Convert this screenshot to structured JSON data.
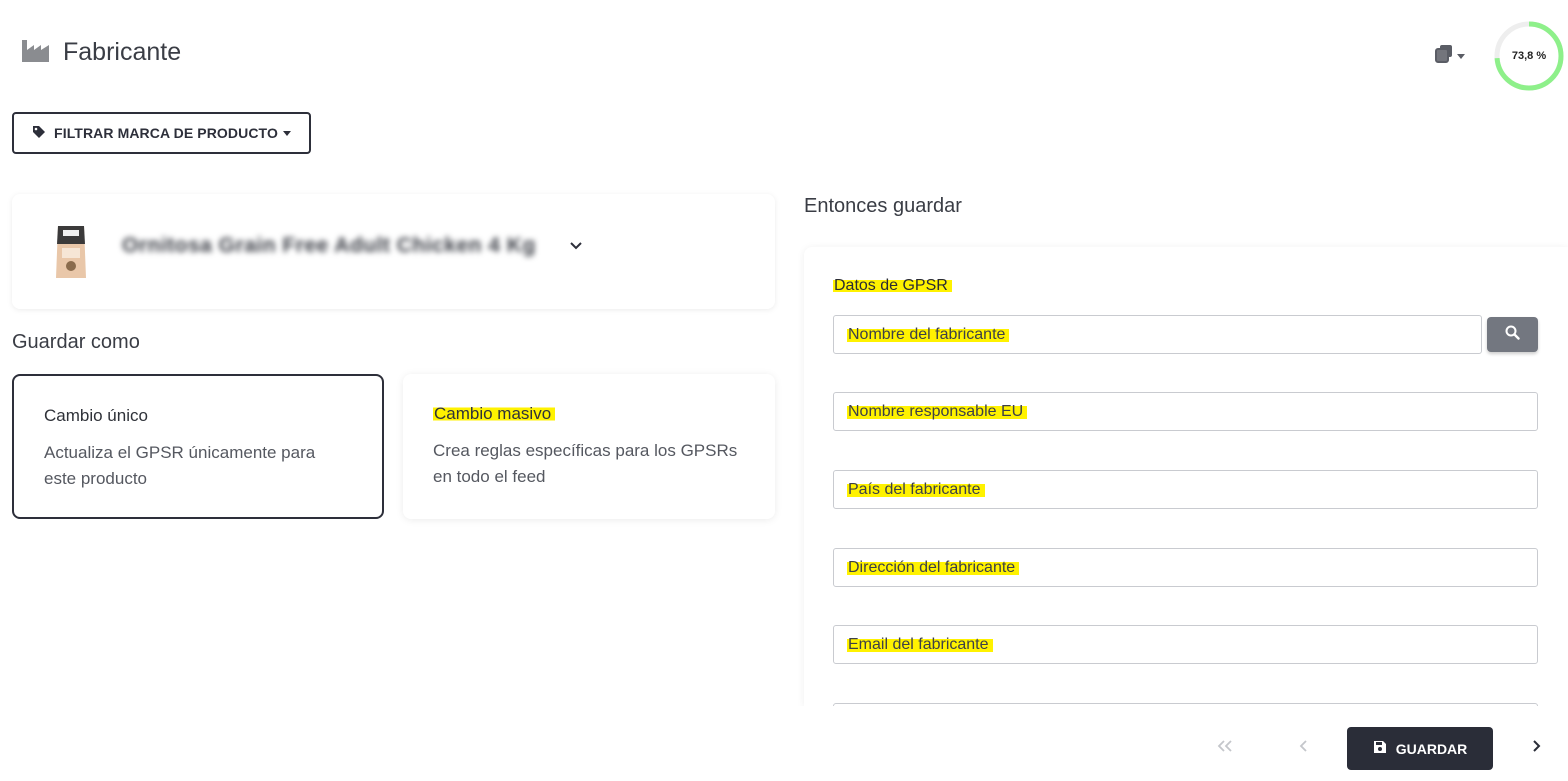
{
  "header": {
    "title": "Fabricante",
    "title_icon": "factory-icon",
    "tools_icon": "copy-stack-icon",
    "progress": {
      "label": "73,8 %",
      "value_percent": 73.8,
      "color": "#8ef08a"
    }
  },
  "filter": {
    "label": "FILTRAR MARCA DE PRODUCTO",
    "icon": "tag-icon"
  },
  "product": {
    "name": "Ornitosa Grain Free Adult Chicken 4 Kg"
  },
  "save_as": {
    "title": "Guardar como",
    "options": [
      {
        "title": "Cambio único",
        "description": "Actualiza el GPSR únicamente para este producto",
        "selected": true
      },
      {
        "title": "Cambio masivo",
        "description": "Crea reglas específicas para los GPSRs en todo el feed",
        "selected": false
      }
    ]
  },
  "gpsr": {
    "section_title": "Entonces guardar",
    "heading": "Datos de GPSR",
    "fields": [
      {
        "placeholder": "Nombre del fabricante"
      },
      {
        "placeholder": "Nombre responsable EU"
      },
      {
        "placeholder": "País del fabricante"
      },
      {
        "placeholder": "Dirección del fabricante"
      },
      {
        "placeholder": "Email del fabricante"
      }
    ]
  },
  "footer": {
    "save_label": "GUARDAR",
    "primary_color": "#2a2d38",
    "highlight_color": "#fff200"
  }
}
